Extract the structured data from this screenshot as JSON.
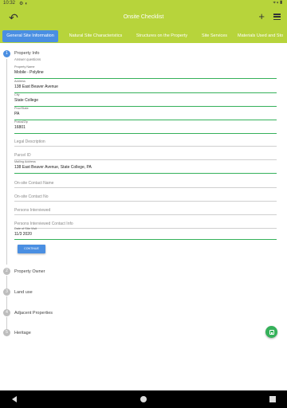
{
  "status_bar": {
    "time": "10:32",
    "left_icons": [
      "gear-icon",
      "data-saver-icon"
    ],
    "right_icons": [
      "location-icon",
      "wifi-icon",
      "battery-icon"
    ]
  },
  "app_bar": {
    "title": "Onsite Checklist",
    "back_icon": "back-icon",
    "plus_label": "+",
    "menu_icon": "menu-icon",
    "background": "#b7d43b"
  },
  "tabs": [
    {
      "label": "General Site Information",
      "active": true
    },
    {
      "label": "Natural Site Characteristics",
      "active": false
    },
    {
      "label": "Structures on the Property",
      "active": false
    },
    {
      "label": "Site Services",
      "active": false
    },
    {
      "label": "Materials Used and Sto",
      "active": false
    }
  ],
  "steps": {
    "property_info": {
      "number": "1",
      "title": "Property Info",
      "subtitle": "Answer questions",
      "fields": [
        {
          "label": "Property Name",
          "value": "Mobile - Polyline"
        },
        {
          "label": "Address",
          "value": "138 East Beaver Avenue"
        },
        {
          "label": "City",
          "value": "State College"
        },
        {
          "label": "Prov/State",
          "value": "PA"
        },
        {
          "label": "Postal/Zip",
          "value": "16801"
        },
        {
          "placeholder": "Legal Description"
        },
        {
          "placeholder": "Parcel ID"
        },
        {
          "label": "Mailing Address",
          "value": "138 East Beaver Avenue, State College, PA"
        },
        {
          "placeholder": "On-site Contact Name"
        },
        {
          "placeholder": "On-site Contact No"
        },
        {
          "placeholder": "Persons Interviewed"
        },
        {
          "placeholder": "Persons Interviewed Contact Info"
        },
        {
          "label": "Date of Site Visit",
          "value": "11/3 2020"
        }
      ],
      "continue_label": "CONTINUE"
    },
    "others": [
      {
        "number": "2",
        "title": "Property Owner"
      },
      {
        "number": "3",
        "title": "Land use"
      },
      {
        "number": "4",
        "title": "Adjacent Properties"
      },
      {
        "number": "5",
        "title": "Heritage"
      }
    ]
  },
  "fab": {
    "icon": "save-icon",
    "color": "#35b15a"
  },
  "navigation_bar": {
    "icons": [
      "back-nav-icon",
      "home-nav-icon",
      "recents-nav-icon"
    ]
  },
  "colors": {
    "accent": "#4a8fe2",
    "valid_underline": "#35b15a",
    "toolbar": "#b7d43b"
  }
}
